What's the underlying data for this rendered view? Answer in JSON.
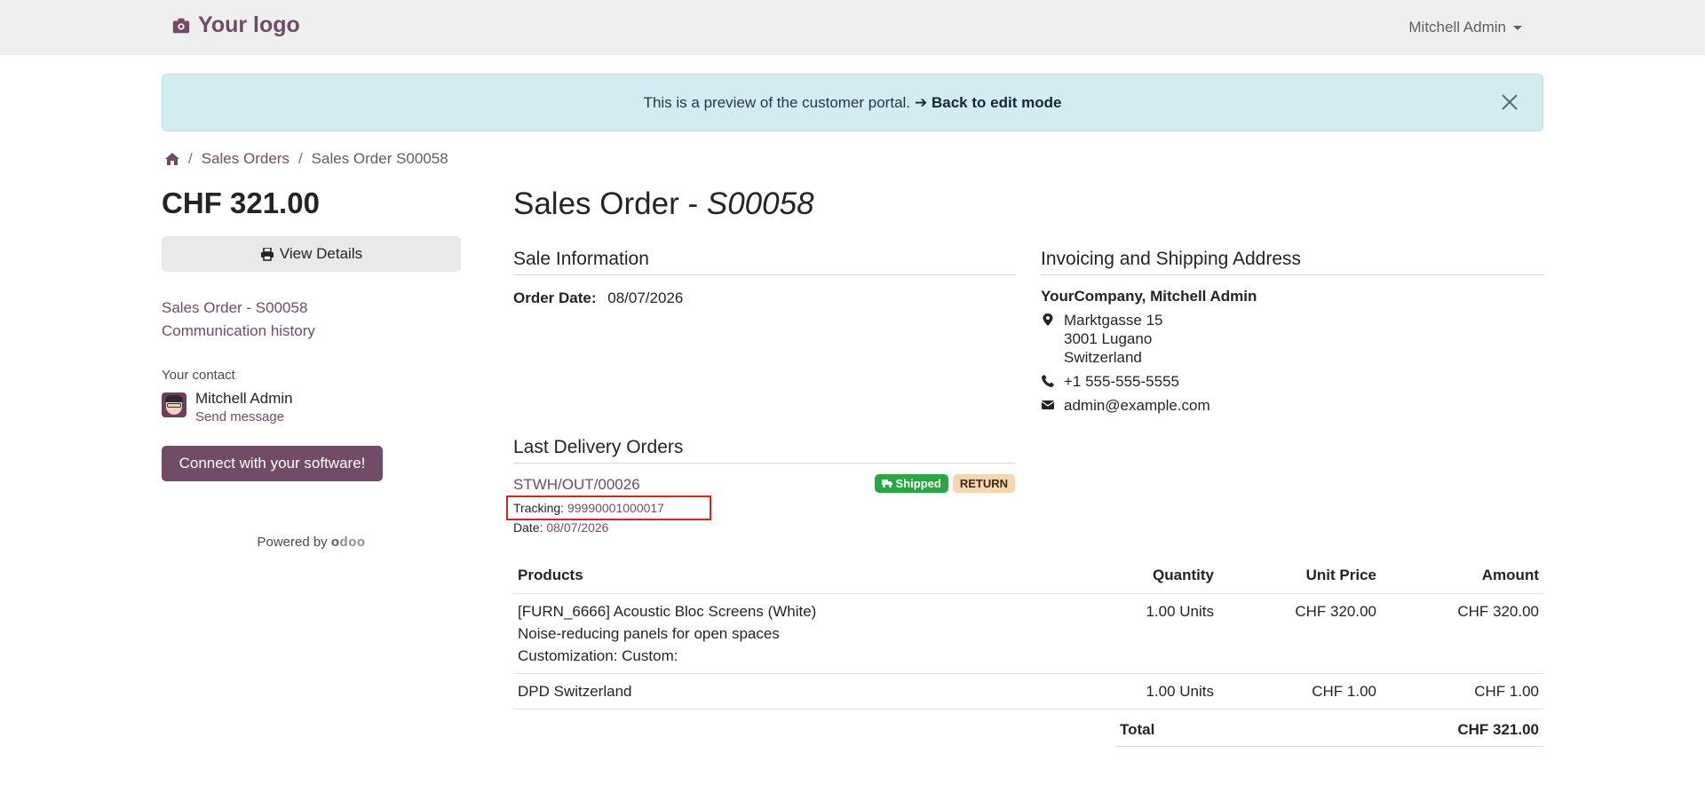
{
  "header": {
    "logo_text": "Your logo",
    "user_name": "Mitchell Admin"
  },
  "alert": {
    "text": "This is a preview of the customer portal.",
    "link": "➔ Back to edit mode"
  },
  "breadcrumb": {
    "level1": "Sales Orders",
    "current": "Sales Order S00058"
  },
  "sidebar": {
    "amount": "CHF 321.00",
    "view_details": "View Details",
    "link_order": "Sales Order - S00058",
    "link_history": "Communication history",
    "contact_label": "Your contact",
    "contact_name": "Mitchell Admin",
    "send_message": "Send message",
    "connect_button": "Connect with your software!",
    "powered_by": "Powered by"
  },
  "main": {
    "title_prefix": "Sales Order - ",
    "title_ref": "S00058",
    "sale_info_title": "Sale Information",
    "order_date_label": "Order Date:",
    "order_date": "08/07/2026",
    "address_title": "Invoicing and Shipping Address",
    "company": "YourCompany, Mitchell Admin",
    "street": "Marktgasse 15",
    "city": "3001 Lugano",
    "country": "Switzerland",
    "phone": "+1 555-555-5555",
    "email": "admin@example.com",
    "delivery_title": "Last Delivery Orders",
    "delivery_ref": "STWH/OUT/00026",
    "badge_shipped": "Shipped",
    "badge_return": "RETURN",
    "tracking_label": "Tracking:",
    "tracking_value": "99990001000017",
    "date_label": "Date:",
    "date_value": "08/07/2026"
  },
  "products": {
    "headers": [
      "Products",
      "Quantity",
      "Unit Price",
      "Amount"
    ],
    "rows": [
      {
        "name": "[FURN_6666] Acoustic Bloc Screens (White)",
        "desc1": "Noise-reducing panels for open spaces",
        "desc2": "Customization: Custom:",
        "qty": "1.00 Units",
        "price": "CHF 320.00",
        "amount": "CHF 320.00"
      },
      {
        "name": "DPD Switzerland",
        "qty": "1.00 Units",
        "price": "CHF 1.00",
        "amount": "CHF 1.00"
      }
    ],
    "total_label": "Total",
    "total_value": "CHF 321.00"
  },
  "colors": {
    "brand": "#714B67",
    "alert_bg": "#d3ecf1",
    "shipped": "#28a745",
    "return": "#f6d5b0",
    "highlight": "#e02020"
  }
}
